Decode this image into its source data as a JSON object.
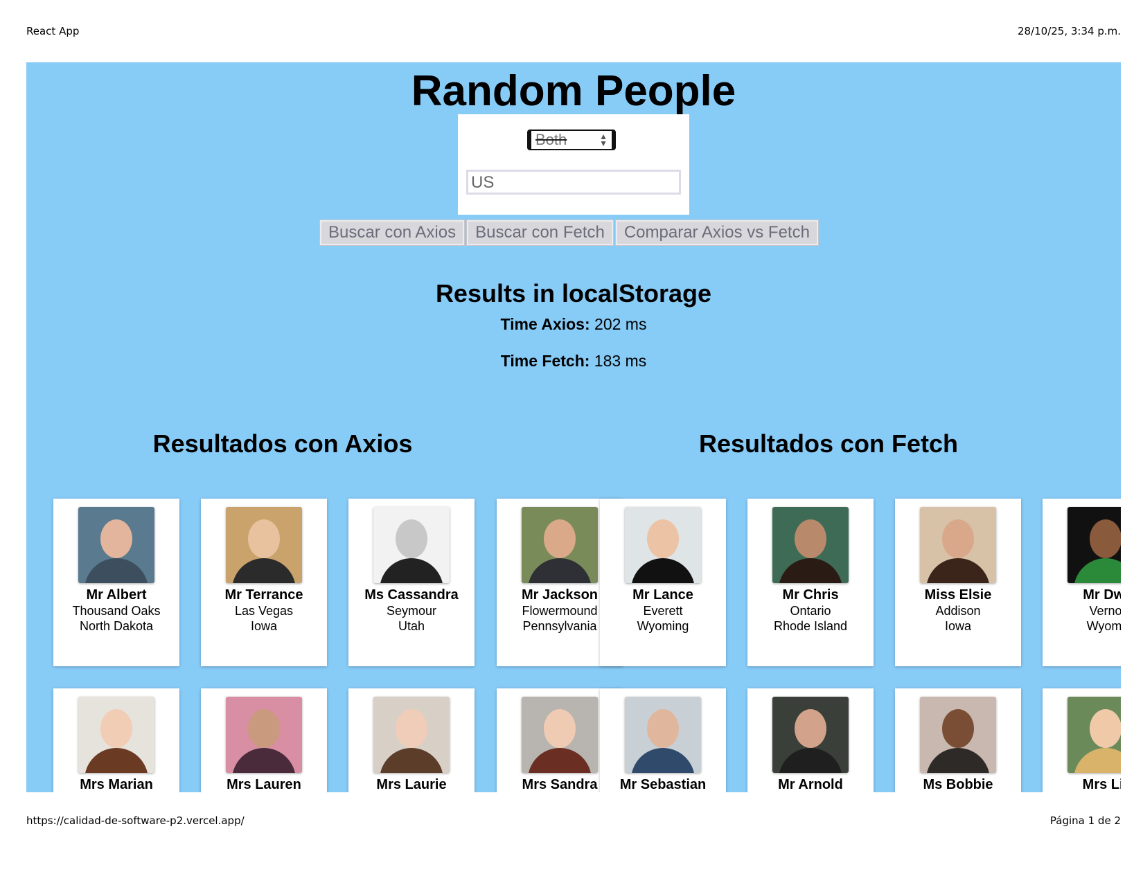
{
  "print_header": {
    "title": "React App",
    "datetime": "28/10/25, 3:34 p.m."
  },
  "print_footer": {
    "url": "https://calidad-de-software-p2.vercel.app/",
    "page": "Página 1 de 2"
  },
  "app": {
    "title": "Random People",
    "gender_select": {
      "value": "Both"
    },
    "country_input": {
      "value": "US"
    },
    "buttons": {
      "axios": "Buscar con Axios",
      "fetch": "Buscar con Fetch",
      "compare": "Comparar Axios vs Fetch"
    },
    "results_heading": "Results in localStorage",
    "time_axios": {
      "label": "Time Axios:",
      "value": "202 ms"
    },
    "time_fetch": {
      "label": "Time Fetch:",
      "value": "183 ms"
    },
    "axios_section": {
      "title": "Resultados con Axios",
      "people": [
        {
          "name": "Mr Albert",
          "city": "Thousand Oaks",
          "state": "North Dakota",
          "colors": [
            "#5a7a8f",
            "#e2b59c",
            "#3d4f5e"
          ]
        },
        {
          "name": "Mr Terrance",
          "city": "Las Vegas",
          "state": "Iowa",
          "colors": [
            "#c9a36b",
            "#e8c19e",
            "#2b2b2b"
          ]
        },
        {
          "name": "Ms Cassandra",
          "city": "Seymour",
          "state": "Utah",
          "colors": [
            "#f2f2f2",
            "#c8c8c8",
            "#222222"
          ]
        },
        {
          "name": "Mr Jackson",
          "city": "Flowermound",
          "state": "Pennsylvania",
          "colors": [
            "#7a8b5a",
            "#d9a98a",
            "#2e3036"
          ]
        },
        {
          "name": "Mrs Marian",
          "city": "",
          "state": "",
          "colors": [
            "#e6e2dc",
            "#f1cdb5",
            "#6b3a22"
          ]
        },
        {
          "name": "Mrs Lauren",
          "city": "",
          "state": "",
          "colors": [
            "#d98fa3",
            "#c99a7e",
            "#4a2b3b"
          ]
        },
        {
          "name": "Mrs Laurie",
          "city": "",
          "state": "",
          "colors": [
            "#d8cfc6",
            "#efcdb8",
            "#5c3d2a"
          ]
        },
        {
          "name": "Mrs Sandra",
          "city": "",
          "state": "",
          "colors": [
            "#b8b4b0",
            "#f0cbb3",
            "#6a2f22"
          ]
        }
      ]
    },
    "fetch_section": {
      "title": "Resultados con Fetch",
      "people": [
        {
          "name": "Mr Lance",
          "city": "Everett",
          "state": "Wyoming",
          "colors": [
            "#dfe4e6",
            "#edc3a6",
            "#111111"
          ]
        },
        {
          "name": "Mr Chris",
          "city": "Ontario",
          "state": "Rhode Island",
          "colors": [
            "#3d6b56",
            "#b88a6b",
            "#2a1c14"
          ]
        },
        {
          "name": "Miss Elsie",
          "city": "Addison",
          "state": "Iowa",
          "colors": [
            "#d7c2a8",
            "#d9a88a",
            "#3b2419"
          ]
        },
        {
          "name": "Mr Dwi",
          "city": "Verno",
          "state": "Wyomi",
          "colors": [
            "#111111",
            "#8a5a3c",
            "#2b8a3a"
          ]
        },
        {
          "name": "Mr Sebastian",
          "city": "",
          "state": "",
          "colors": [
            "#c8d0d6",
            "#e0b79d",
            "#2f4a6a"
          ]
        },
        {
          "name": "Mr Arnold",
          "city": "",
          "state": "",
          "colors": [
            "#3a3f3a",
            "#d2a38a",
            "#1f1f1f"
          ]
        },
        {
          "name": "Ms Bobbie",
          "city": "",
          "state": "",
          "colors": [
            "#c9b8b0",
            "#7a4e35",
            "#2e2a28"
          ]
        },
        {
          "name": "Mrs Lir",
          "city": "",
          "state": "",
          "colors": [
            "#6a8a5a",
            "#f0c9a8",
            "#d9b36a"
          ]
        }
      ]
    }
  }
}
